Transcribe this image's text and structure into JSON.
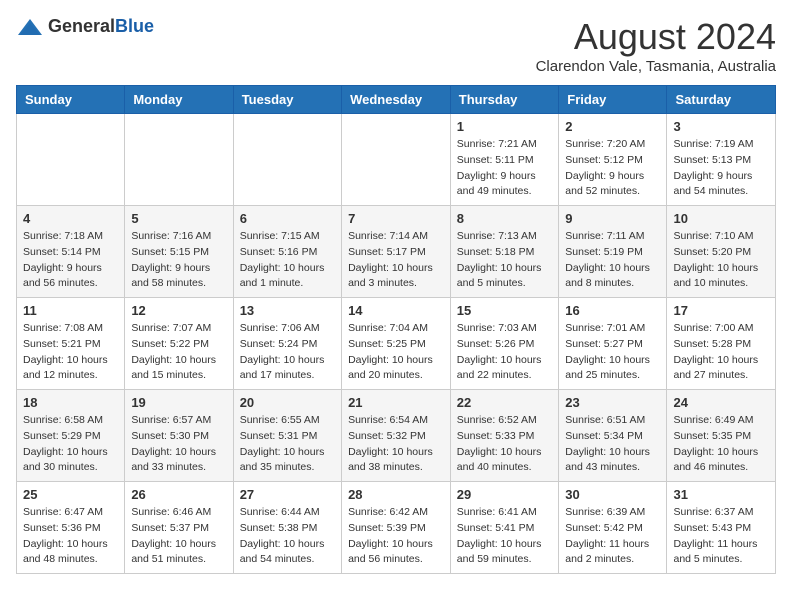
{
  "header": {
    "logo_general": "General",
    "logo_blue": "Blue",
    "main_title": "August 2024",
    "subtitle": "Clarendon Vale, Tasmania, Australia"
  },
  "calendar": {
    "headers": [
      "Sunday",
      "Monday",
      "Tuesday",
      "Wednesday",
      "Thursday",
      "Friday",
      "Saturday"
    ],
    "rows": [
      [
        {
          "day": "",
          "info": ""
        },
        {
          "day": "",
          "info": ""
        },
        {
          "day": "",
          "info": ""
        },
        {
          "day": "",
          "info": ""
        },
        {
          "day": "1",
          "info": "Sunrise: 7:21 AM\nSunset: 5:11 PM\nDaylight: 9 hours\nand 49 minutes."
        },
        {
          "day": "2",
          "info": "Sunrise: 7:20 AM\nSunset: 5:12 PM\nDaylight: 9 hours\nand 52 minutes."
        },
        {
          "day": "3",
          "info": "Sunrise: 7:19 AM\nSunset: 5:13 PM\nDaylight: 9 hours\nand 54 minutes."
        }
      ],
      [
        {
          "day": "4",
          "info": "Sunrise: 7:18 AM\nSunset: 5:14 PM\nDaylight: 9 hours\nand 56 minutes."
        },
        {
          "day": "5",
          "info": "Sunrise: 7:16 AM\nSunset: 5:15 PM\nDaylight: 9 hours\nand 58 minutes."
        },
        {
          "day": "6",
          "info": "Sunrise: 7:15 AM\nSunset: 5:16 PM\nDaylight: 10 hours\nand 1 minute."
        },
        {
          "day": "7",
          "info": "Sunrise: 7:14 AM\nSunset: 5:17 PM\nDaylight: 10 hours\nand 3 minutes."
        },
        {
          "day": "8",
          "info": "Sunrise: 7:13 AM\nSunset: 5:18 PM\nDaylight: 10 hours\nand 5 minutes."
        },
        {
          "day": "9",
          "info": "Sunrise: 7:11 AM\nSunset: 5:19 PM\nDaylight: 10 hours\nand 8 minutes."
        },
        {
          "day": "10",
          "info": "Sunrise: 7:10 AM\nSunset: 5:20 PM\nDaylight: 10 hours\nand 10 minutes."
        }
      ],
      [
        {
          "day": "11",
          "info": "Sunrise: 7:08 AM\nSunset: 5:21 PM\nDaylight: 10 hours\nand 12 minutes."
        },
        {
          "day": "12",
          "info": "Sunrise: 7:07 AM\nSunset: 5:22 PM\nDaylight: 10 hours\nand 15 minutes."
        },
        {
          "day": "13",
          "info": "Sunrise: 7:06 AM\nSunset: 5:24 PM\nDaylight: 10 hours\nand 17 minutes."
        },
        {
          "day": "14",
          "info": "Sunrise: 7:04 AM\nSunset: 5:25 PM\nDaylight: 10 hours\nand 20 minutes."
        },
        {
          "day": "15",
          "info": "Sunrise: 7:03 AM\nSunset: 5:26 PM\nDaylight: 10 hours\nand 22 minutes."
        },
        {
          "day": "16",
          "info": "Sunrise: 7:01 AM\nSunset: 5:27 PM\nDaylight: 10 hours\nand 25 minutes."
        },
        {
          "day": "17",
          "info": "Sunrise: 7:00 AM\nSunset: 5:28 PM\nDaylight: 10 hours\nand 27 minutes."
        }
      ],
      [
        {
          "day": "18",
          "info": "Sunrise: 6:58 AM\nSunset: 5:29 PM\nDaylight: 10 hours\nand 30 minutes."
        },
        {
          "day": "19",
          "info": "Sunrise: 6:57 AM\nSunset: 5:30 PM\nDaylight: 10 hours\nand 33 minutes."
        },
        {
          "day": "20",
          "info": "Sunrise: 6:55 AM\nSunset: 5:31 PM\nDaylight: 10 hours\nand 35 minutes."
        },
        {
          "day": "21",
          "info": "Sunrise: 6:54 AM\nSunset: 5:32 PM\nDaylight: 10 hours\nand 38 minutes."
        },
        {
          "day": "22",
          "info": "Sunrise: 6:52 AM\nSunset: 5:33 PM\nDaylight: 10 hours\nand 40 minutes."
        },
        {
          "day": "23",
          "info": "Sunrise: 6:51 AM\nSunset: 5:34 PM\nDaylight: 10 hours\nand 43 minutes."
        },
        {
          "day": "24",
          "info": "Sunrise: 6:49 AM\nSunset: 5:35 PM\nDaylight: 10 hours\nand 46 minutes."
        }
      ],
      [
        {
          "day": "25",
          "info": "Sunrise: 6:47 AM\nSunset: 5:36 PM\nDaylight: 10 hours\nand 48 minutes."
        },
        {
          "day": "26",
          "info": "Sunrise: 6:46 AM\nSunset: 5:37 PM\nDaylight: 10 hours\nand 51 minutes."
        },
        {
          "day": "27",
          "info": "Sunrise: 6:44 AM\nSunset: 5:38 PM\nDaylight: 10 hours\nand 54 minutes."
        },
        {
          "day": "28",
          "info": "Sunrise: 6:42 AM\nSunset: 5:39 PM\nDaylight: 10 hours\nand 56 minutes."
        },
        {
          "day": "29",
          "info": "Sunrise: 6:41 AM\nSunset: 5:41 PM\nDaylight: 10 hours\nand 59 minutes."
        },
        {
          "day": "30",
          "info": "Sunrise: 6:39 AM\nSunset: 5:42 PM\nDaylight: 11 hours\nand 2 minutes."
        },
        {
          "day": "31",
          "info": "Sunrise: 6:37 AM\nSunset: 5:43 PM\nDaylight: 11 hours\nand 5 minutes."
        }
      ]
    ]
  }
}
